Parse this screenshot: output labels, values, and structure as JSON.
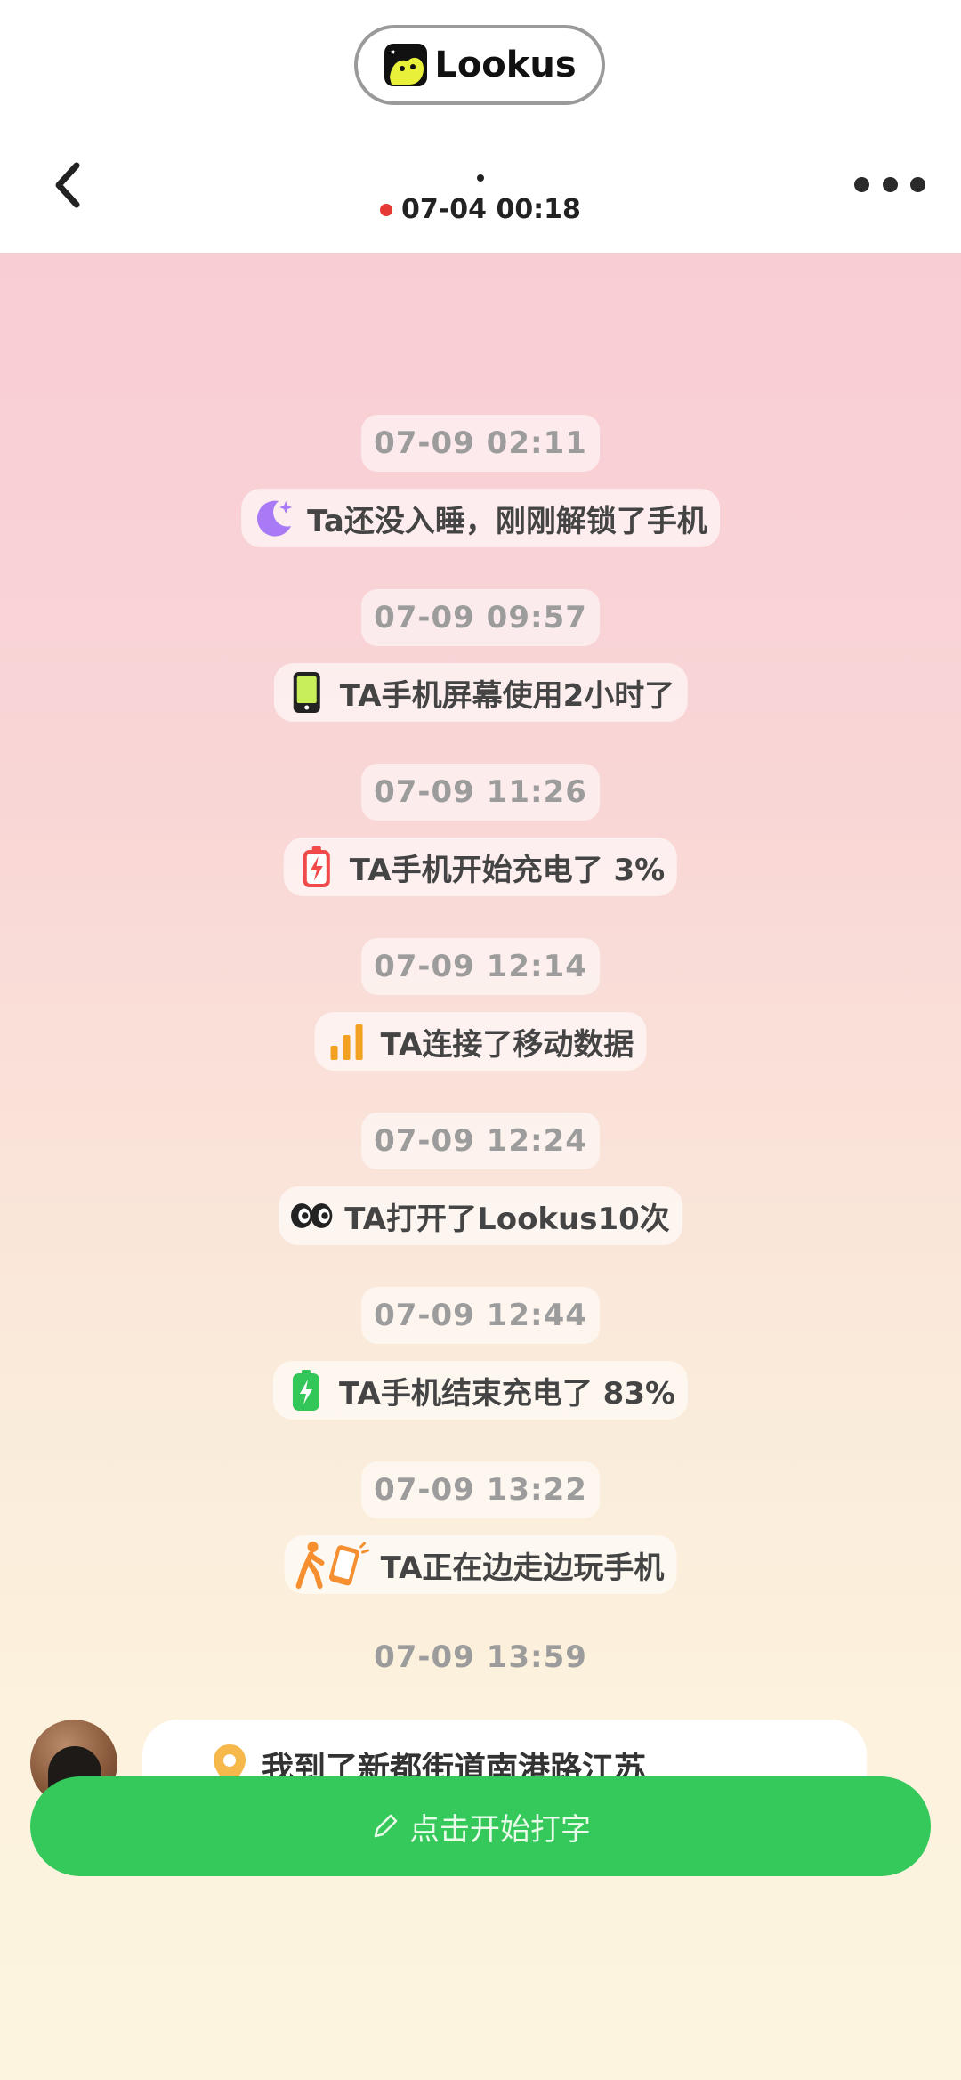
{
  "app": {
    "name": "Lookus"
  },
  "header": {
    "time": "07-04 00:18"
  },
  "feed": [
    {
      "time": "07-09 02:11",
      "icon": "moon-icon",
      "text": "Ta还没入睡，刚刚解锁了手机"
    },
    {
      "time": "07-09 09:57",
      "icon": "phone-screen-icon",
      "text": "TA手机屏幕使用2小时了"
    },
    {
      "time": "07-09 11:26",
      "icon": "battery-low-charging-icon",
      "text": "TA手机开始充电了 3%"
    },
    {
      "time": "07-09 12:14",
      "icon": "signal-bars-icon",
      "text": "TA连接了移动数据"
    },
    {
      "time": "07-09 12:24",
      "icon": "eyes-icon",
      "text": "TA打开了Lookus10次"
    },
    {
      "time": "07-09 12:44",
      "icon": "battery-full-charging-icon",
      "text": "TA手机结束充电了 83%"
    },
    {
      "time": "07-09 13:22",
      "icon": "walking-phone-icon",
      "text": "TA正在边走边玩手机"
    }
  ],
  "last_timestamp": "07-09 13:59",
  "location_message": {
    "icon": "location-pin-icon",
    "text": "我到了新都街道南港路江苏"
  },
  "input": {
    "label": "点击开始打字",
    "icon": "pencil-icon"
  },
  "colors": {
    "accent_green": "#35c85a",
    "status_red": "#e53935",
    "moon_purple": "#a97af5",
    "battery_red": "#f04a4a",
    "battery_green": "#33c75a",
    "signal_orange": "#f2a122",
    "walker_orange": "#f58f2f"
  }
}
